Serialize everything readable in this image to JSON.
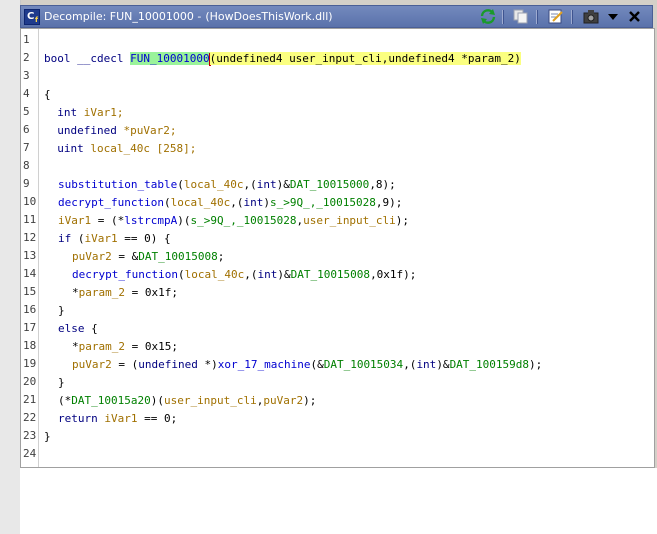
{
  "window": {
    "title_prefix": "Decompile: FUN_10001000 -",
    "title_file": "(HowDoesThisWork.dll)"
  },
  "toolbar": {
    "icons": [
      "refresh-icon",
      "copy-icon",
      "edit-icon",
      "snapshot-icon",
      "dropdown-menu-icon",
      "close-icon"
    ]
  },
  "code": {
    "line_numbers": [
      "1",
      "2",
      "3",
      "4",
      "5",
      "6",
      "7",
      "8",
      "9",
      "10",
      "11",
      "12",
      "13",
      "14",
      "15",
      "16",
      "17",
      "18",
      "19",
      "20",
      "21",
      "22",
      "23",
      "24"
    ],
    "l2_bool": "bool",
    "l2_cdecl": "__cdecl",
    "l2_fn": "FUN_10001000",
    "l2_params": "(undefined4 user_input_cli,undefined4 *param_2)",
    "l4": "{",
    "l5_type": "int",
    "l5_var": "iVar1;",
    "l6_type": "undefined",
    "l6_var": "*puVar2;",
    "l7_type": "uint",
    "l7_var": "local_40c [258];",
    "l9": "substitution_table(local_40c,(int)&DAT_10015000,8);",
    "l10": "decrypt_function(local_40c,(int)s_>9Q_,_10015028,9);",
    "l11": "iVar1 = (*lstrcmpA)(s_>9Q_,_10015028,user_input_cli);",
    "l12": "if (iVar1 == 0) {",
    "l13": "puVar2 = &DAT_10015008;",
    "l14": "decrypt_function(local_40c,(int)&DAT_10015008,0x1f);",
    "l15": "*param_2 = 0x1f;",
    "l16": "}",
    "l17": "else {",
    "l18": "*param_2 = 0x15;",
    "l19": "puVar2 = (undefined *)xor_17_machine(&DAT_10015034,(int)&DAT_100159d8);",
    "l20": "}",
    "l21": "(*DAT_10015a20)(user_input_cli,puVar2);",
    "l22": "return iVar1 == 0;",
    "l23": "}"
  },
  "colors": {
    "title_bar": "#5a72ab",
    "function_highlight": "#9af39a",
    "signature_highlight": "#fbff80",
    "keyword": "#000080",
    "function_name": "#0000d0",
    "variable": "#a07000",
    "global": "#008000"
  }
}
